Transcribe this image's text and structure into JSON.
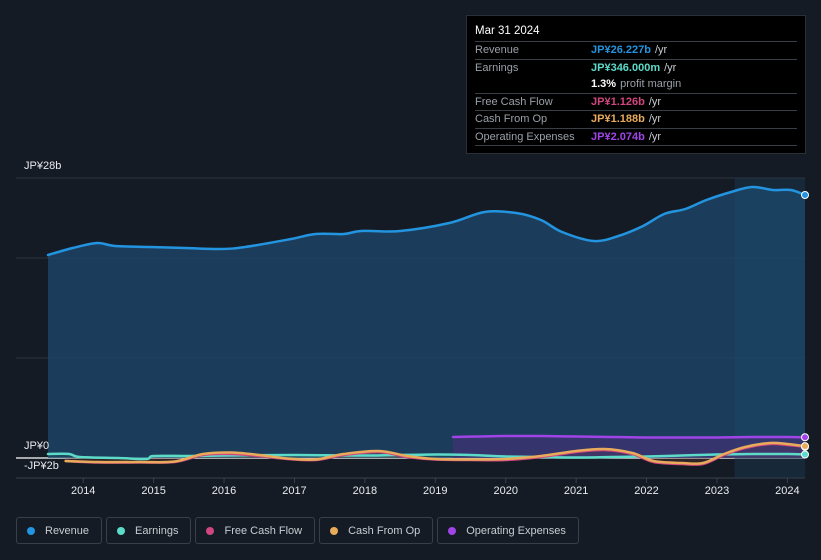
{
  "tooltip": {
    "date": "Mar 31 2024",
    "rows": [
      {
        "label": "Revenue",
        "value": "JP¥26.227b",
        "unit": "/yr",
        "color": "#2394df"
      },
      {
        "label": "Earnings",
        "value": "JP¥346.000m",
        "unit": "/yr",
        "color": "#5ddbc9"
      },
      {
        "label": "",
        "margin_value": "1.3%",
        "margin_text": "profit margin"
      },
      {
        "label": "Free Cash Flow",
        "value": "JP¥1.126b",
        "unit": "/yr",
        "color": "#d1467f"
      },
      {
        "label": "Cash From Op",
        "value": "JP¥1.188b",
        "unit": "/yr",
        "color": "#e8ab5c"
      },
      {
        "label": "Operating Expenses",
        "value": "JP¥2.074b",
        "unit": "/yr",
        "color": "#a044e8"
      }
    ]
  },
  "legend": [
    {
      "label": "Revenue",
      "color": "#2394df"
    },
    {
      "label": "Earnings",
      "color": "#5ddbc9"
    },
    {
      "label": "Free Cash Flow",
      "color": "#d1467f"
    },
    {
      "label": "Cash From Op",
      "color": "#e8ab5c"
    },
    {
      "label": "Operating Expenses",
      "color": "#a044e8"
    }
  ],
  "chart_data": {
    "type": "area",
    "title": "",
    "xlabel": "",
    "ylabel": "",
    "y_tick_labels": [
      {
        "value": 28,
        "label": "JP¥28b"
      },
      {
        "value": 0,
        "label": "JP¥0"
      },
      {
        "value": -2,
        "label": "-JP¥2b"
      }
    ],
    "x_tick_labels": [
      "2014",
      "2015",
      "2016",
      "2017",
      "2018",
      "2019",
      "2020",
      "2021",
      "2022",
      "2023",
      "2024"
    ],
    "x_ticks": [
      2014,
      2015,
      2016,
      2017,
      2018,
      2019,
      2020,
      2021,
      2022,
      2023,
      2024
    ],
    "xlim": [
      2013.5,
      2024.25
    ],
    "ylim": [
      -2,
      28
    ],
    "gridlines": [
      28,
      20,
      10,
      0
    ],
    "highlight_from": 2023.25,
    "units": "JP¥ billions",
    "series": [
      {
        "name": "Revenue",
        "color": "#2394df",
        "x": [
          2013.5,
          2013.85,
          2014.2,
          2014.45,
          2014.95,
          2015.45,
          2015.95,
          2016.3,
          2016.95,
          2017.3,
          2017.7,
          2017.95,
          2018.5,
          2019.2,
          2019.7,
          2020.15,
          2020.5,
          2020.8,
          2021.25,
          2021.6,
          2021.95,
          2022.25,
          2022.55,
          2022.85,
          2023.2,
          2023.5,
          2023.8,
          2024.05,
          2024.25
        ],
        "values": [
          20.3,
          21.0,
          21.5,
          21.2,
          21.1,
          21.0,
          20.9,
          21.1,
          21.9,
          22.4,
          22.4,
          22.7,
          22.7,
          23.5,
          24.6,
          24.5,
          23.8,
          22.6,
          21.7,
          22.2,
          23.2,
          24.4,
          24.9,
          25.8,
          26.6,
          27.1,
          26.8,
          26.8,
          26.3
        ]
      },
      {
        "name": "Earnings",
        "color": "#5ddbc9",
        "x": [
          2013.5,
          2013.8,
          2013.95,
          2014.5,
          2014.9,
          2015.0,
          2015.5,
          2016.0,
          2017.0,
          2018.0,
          2019.0,
          2019.5,
          2020.0,
          2020.5,
          2021.0,
          2021.5,
          2022.0,
          2022.5,
          2023.0,
          2023.5,
          2024.0,
          2024.25
        ],
        "values": [
          0.4,
          0.4,
          0.1,
          0.0,
          -0.1,
          0.2,
          0.2,
          0.25,
          0.3,
          0.25,
          0.35,
          0.3,
          0.15,
          0.1,
          0.05,
          0.1,
          0.15,
          0.25,
          0.35,
          0.4,
          0.4,
          0.35
        ]
      },
      {
        "name": "Free Cash Flow",
        "color": "#d1467f",
        "x": [
          2013.75,
          2014.2,
          2014.8,
          2015.3,
          2015.7,
          2016.1,
          2016.5,
          2016.9,
          2017.3,
          2017.7,
          2018.2,
          2018.6,
          2019.0,
          2019.5,
          2020.0,
          2020.5,
          2021.0,
          2021.4,
          2021.8,
          2022.1,
          2022.5,
          2022.8,
          2023.1,
          2023.4,
          2023.75,
          2024.0,
          2024.25
        ],
        "values": [
          -0.3,
          -0.45,
          -0.45,
          -0.4,
          0.3,
          0.4,
          0.2,
          -0.1,
          -0.2,
          0.3,
          0.6,
          0.1,
          -0.15,
          -0.2,
          -0.2,
          0.1,
          0.6,
          0.8,
          0.4,
          -0.4,
          -0.6,
          -0.6,
          0.3,
          1.0,
          1.4,
          1.3,
          1.126
        ]
      },
      {
        "name": "Cash From Op",
        "color": "#e8ab5c",
        "x": [
          2013.75,
          2014.2,
          2014.8,
          2015.3,
          2015.7,
          2016.1,
          2016.5,
          2016.9,
          2017.3,
          2017.7,
          2018.2,
          2018.6,
          2019.0,
          2019.5,
          2020.0,
          2020.5,
          2021.0,
          2021.4,
          2021.8,
          2022.1,
          2022.5,
          2022.8,
          2023.1,
          2023.4,
          2023.75,
          2024.0,
          2024.25
        ],
        "values": [
          -0.3,
          -0.4,
          -0.4,
          -0.35,
          0.4,
          0.55,
          0.3,
          -0.05,
          -0.15,
          0.4,
          0.7,
          0.2,
          -0.1,
          -0.15,
          -0.1,
          0.2,
          0.7,
          0.9,
          0.5,
          -0.3,
          -0.5,
          -0.5,
          0.4,
          1.1,
          1.5,
          1.4,
          1.188
        ]
      },
      {
        "name": "Operating Expenses",
        "color": "#a044e8",
        "x": [
          2019.25,
          2019.6,
          2020.0,
          2020.5,
          2021.0,
          2021.5,
          2022.0,
          2022.5,
          2023.0,
          2023.5,
          2024.0,
          2024.25
        ],
        "values": [
          2.1,
          2.15,
          2.2,
          2.2,
          2.15,
          2.1,
          2.05,
          2.05,
          2.05,
          2.1,
          2.1,
          2.074
        ]
      }
    ]
  }
}
